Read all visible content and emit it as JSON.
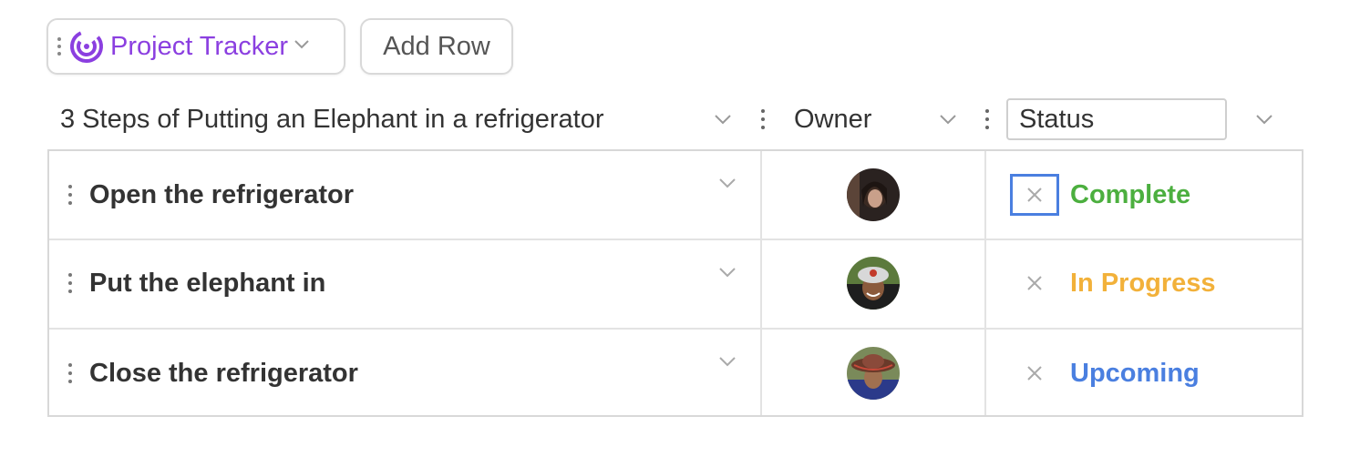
{
  "toolbar": {
    "tracker_label": "Project Tracker",
    "add_row_label": "Add Row"
  },
  "header": {
    "title": "3 Steps of Putting an Elephant in a refrigerator",
    "owner": "Owner",
    "status": "Status"
  },
  "rows": [
    {
      "task": "Open the refrigerator",
      "status": "Complete",
      "status_color": "#4caf3f"
    },
    {
      "task": "Put the elephant in",
      "status": "In Progress",
      "status_color": "#f2b13a"
    },
    {
      "task": "Close the refrigerator",
      "status": "Upcoming",
      "status_color": "#4a7fe0"
    }
  ],
  "colors": {
    "accent": "#8b3fe0",
    "focus": "#4a7fe0"
  }
}
